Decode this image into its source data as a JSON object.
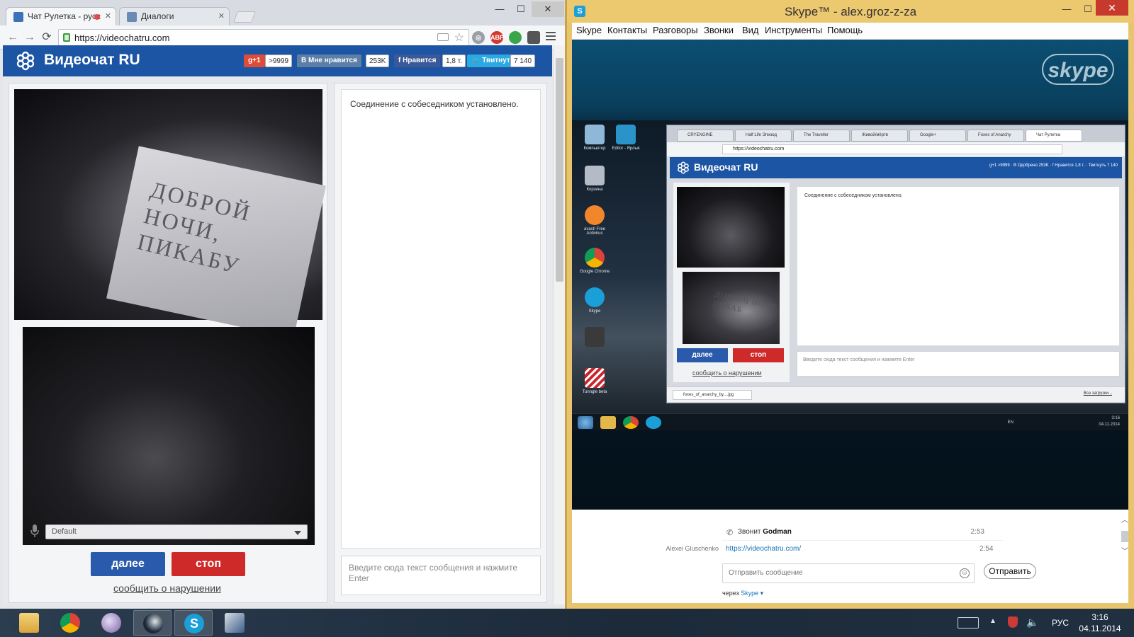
{
  "chrome": {
    "tabs": [
      {
        "label": "Чат Рулетка - русс",
        "active": true
      },
      {
        "label": "Диалоги",
        "active": false
      }
    ],
    "url": "https://videochatru.com",
    "window_controls": {
      "minimize": "—",
      "maximize": "☐",
      "close": "✕"
    }
  },
  "site": {
    "title": "Видеочат RU",
    "social": {
      "gplus_label": "g+1",
      "gplus_count": ">9999",
      "vk_label": "Мне нравится",
      "vk_count": "253K",
      "fb_label": "Нравится",
      "fb_count": "1,8 т.",
      "tw_label": "Твитнуть",
      "tw_count": "7 140"
    },
    "paper_text": "ДОБРОЙ НОЧИ, ПИКАБУ",
    "mic_select_value": "Default",
    "next_label": "далее",
    "stop_label": "стоп",
    "report_label": "сообщить о нарушении",
    "chat_message": "Соединение с собеседником установлено.",
    "chat_placeholder": "Введите сюда текст сообщения и нажмите Enter"
  },
  "skype": {
    "window_title": "Skype™ - alex.groz-z-za",
    "menu": [
      "Skype",
      "Контакты",
      "Разговоры",
      "Звонки",
      "Вид",
      "Инструменты",
      "Помощь"
    ],
    "logo_text": "skype",
    "remote_desktop": {
      "icons": [
        "Компьютер",
        "Editor - Ярлык",
        "Корзина",
        "avast! Free Antivirus",
        "Google Chrome",
        "Skype",
        "",
        "Tunngle beta"
      ],
      "tabs": [
        "CRYENGINE",
        "Half Life Эпизод",
        "The Traveller",
        "Живой/мёртв",
        "Google+",
        "Foxes of Anarchy",
        "Чат Рулетка"
      ],
      "url": "https://videochatru.com",
      "title": "Видеочат RU",
      "social_text": "g+1 >9999 · В Одобрено 253K · f Нравится 1,8 т. · Твитнуть 7 140",
      "paper_text": "ДОБРОЙ НОЧИ ПИКАБ",
      "next_label": "далее",
      "stop_label": "стоп",
      "report_label": "сообщить о нарушении",
      "chat_message": "Соединение с собеседником установлено.",
      "chat_placeholder": "Введите сюда текст сообщения и нажмите Enter",
      "download_file": "foxes_of_anarchy_by....jpg",
      "download_all": "Все загрузки...",
      "tray_lang": "EN",
      "tray_time": "3:16",
      "tray_date": "04.11.2014"
    },
    "chat": {
      "call_text": "Звонит",
      "caller": "Godman",
      "call_time": "2:53",
      "author": "Alexei Gluschenko",
      "link": "https://videochatru.com/",
      "link_time": "2:54",
      "input_placeholder": "Отправить сообщение",
      "send_label": "Отправить",
      "via_text": "через",
      "via_link": "Skype ▾"
    }
  },
  "taskbar": {
    "apps": [
      "file-explorer",
      "chrome",
      "foobar",
      "steam",
      "skype",
      "editor"
    ],
    "lang": "РУС",
    "time": "3:16",
    "date": "04.11.2014"
  },
  "colors": {
    "site_blue": "#1d55a5",
    "next_btn": "#2a5aab",
    "stop_btn": "#cf2a2a",
    "skype_frame": "#e8c56d",
    "skype_close": "#c7392d"
  }
}
